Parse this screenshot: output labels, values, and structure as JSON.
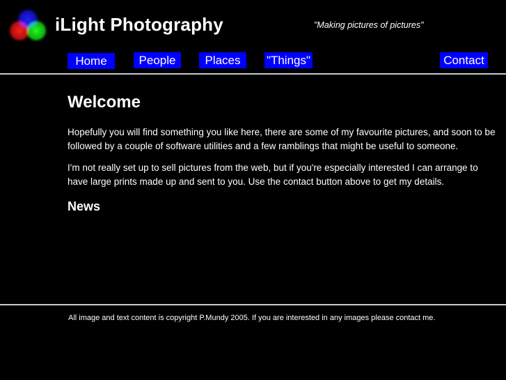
{
  "header": {
    "site_title": "iLight Photography",
    "tagline": "\"Making pictures of pictures\"",
    "logo_icon": "rgb-circles-logo"
  },
  "nav": {
    "home": "Home",
    "people": "People",
    "places": "Places",
    "things": "\"Things\"",
    "contact": "Contact",
    "button_color": "#0000ff"
  },
  "main": {
    "heading": "Welcome",
    "paragraph_1": "Hopefully you will find something you like here, there are some of my favourite pictures, and soon to be followed by a couple of software utilities and a few ramblings that might be useful to someone.",
    "paragraph_2": "I'm not really set up to sell pictures from the web, but if you're especially interested I can arrange to have large prints made up and sent to you. Use the contact button above to get my details.",
    "news_heading": "News"
  },
  "footer": {
    "copyright": "All image and text content is copyright P.Mundy 2005. If you are interested in any images please contact me."
  },
  "colors": {
    "background": "#000000",
    "text": "#ffffff",
    "rule": "#c8c8c8"
  }
}
